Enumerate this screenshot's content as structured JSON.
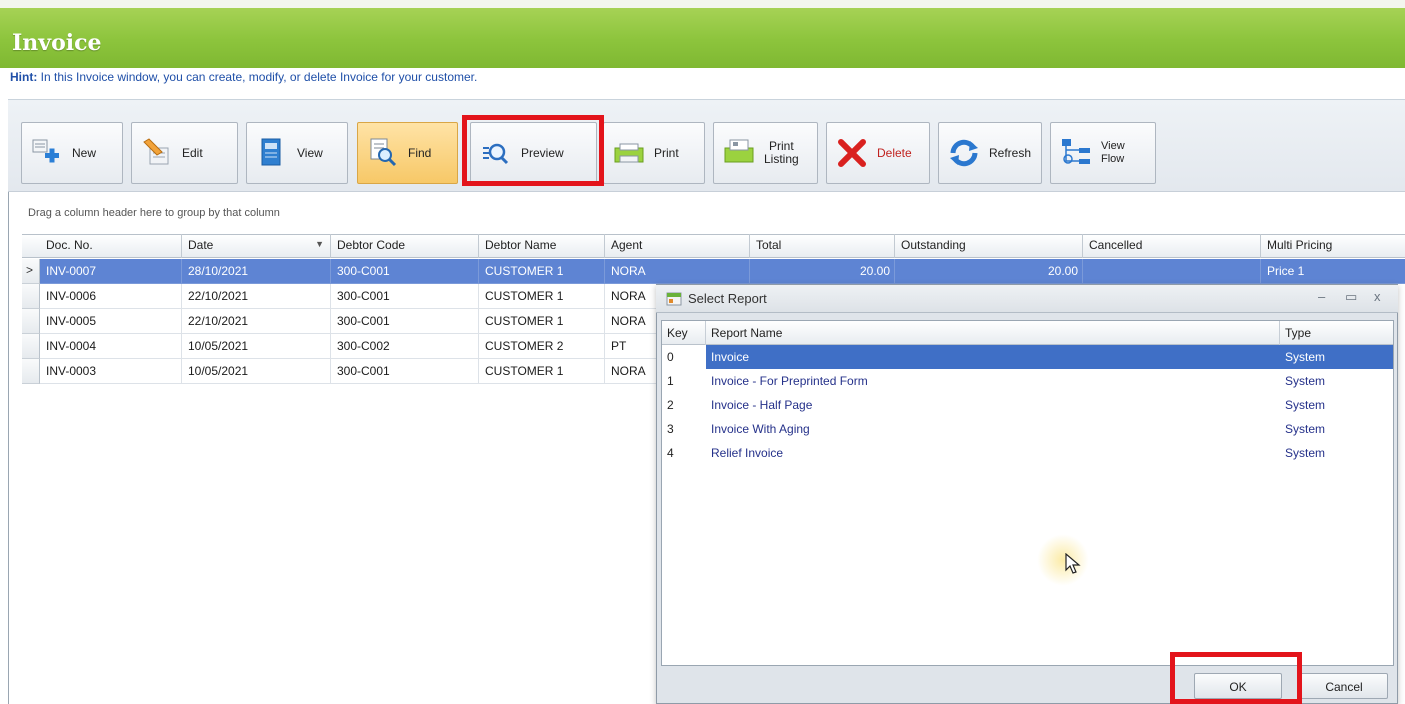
{
  "window": {
    "title": "Invoice",
    "hint_label": "Hint:",
    "hint_text": "In this Invoice window, you can create, modify, or delete Invoice for your customer."
  },
  "toolbar": {
    "buttons": [
      {
        "label": "New",
        "icon": "new-document-plus-icon"
      },
      {
        "label": "Edit",
        "icon": "pencil-edit-icon"
      },
      {
        "label": "View",
        "icon": "view-document-icon"
      },
      {
        "label": "Find",
        "icon": "find-magnifier-icon",
        "state": "active"
      },
      {
        "label": "Preview",
        "icon": "preview-magnifier-icon",
        "highlighted": true
      },
      {
        "label": "Print",
        "icon": "printer-icon"
      },
      {
        "label": "Print\nListing",
        "line1": "Print",
        "line2": "Listing",
        "icon": "print-listing-icon"
      },
      {
        "label": "Delete",
        "icon": "red-x-delete-icon"
      },
      {
        "label": "Refresh",
        "icon": "refresh-arrows-icon"
      },
      {
        "label": "View\nFlow",
        "line1": "View",
        "line2": "Flow",
        "icon": "flow-diagram-icon"
      }
    ]
  },
  "grid": {
    "group_hint": "Drag a column header here to group by that column",
    "columns": [
      "Doc. No.",
      "Date",
      "Debtor Code",
      "Debtor Name",
      "Agent",
      "Total",
      "Outstanding",
      "Cancelled",
      "Multi Pricing"
    ],
    "sort_indicator": "▼",
    "rows": [
      {
        "doc_no": "INV-0007",
        "date": "28/10/2021",
        "debtor_code": "300-C001",
        "debtor_name": "CUSTOMER 1",
        "agent": "NORA",
        "total": "20.00",
        "outstanding": "20.00",
        "cancelled": "",
        "multi_pricing": "Price 1",
        "selected": true
      },
      {
        "doc_no": "INV-0006",
        "date": "22/10/2021",
        "debtor_code": "300-C001",
        "debtor_name": "CUSTOMER 1",
        "agent": "NORA"
      },
      {
        "doc_no": "INV-0005",
        "date": "22/10/2021",
        "debtor_code": "300-C001",
        "debtor_name": "CUSTOMER 1",
        "agent": "NORA"
      },
      {
        "doc_no": "INV-0004",
        "date": "10/05/2021",
        "debtor_code": "300-C002",
        "debtor_name": "CUSTOMER 2",
        "agent": "PT"
      },
      {
        "doc_no": "INV-0003",
        "date": "10/05/2021",
        "debtor_code": "300-C001",
        "debtor_name": "CUSTOMER 1",
        "agent": "NORA"
      }
    ]
  },
  "dialog": {
    "title": "Select Report",
    "window_buttons": {
      "minimize": "–",
      "maximize": "▭",
      "close": "x"
    },
    "columns": [
      "Key",
      "Report Name",
      "Type"
    ],
    "rows": [
      {
        "key": "0",
        "name": "Invoice",
        "type": "System",
        "selected": true
      },
      {
        "key": "1",
        "name": "Invoice - For Preprinted Form",
        "type": "System"
      },
      {
        "key": "2",
        "name": "Invoice - Half Page",
        "type": "System"
      },
      {
        "key": "3",
        "name": "Invoice With Aging",
        "type": "System"
      },
      {
        "key": "4",
        "name": "Relief Invoice",
        "type": "System"
      }
    ],
    "ok_label": "OK",
    "cancel_label": "Cancel"
  },
  "colors": {
    "title_green": "#8cc43c",
    "selection_blue": "#5e84d3",
    "dialog_selection_blue": "#3f6fc6",
    "highlight_red": "#e3141b"
  }
}
